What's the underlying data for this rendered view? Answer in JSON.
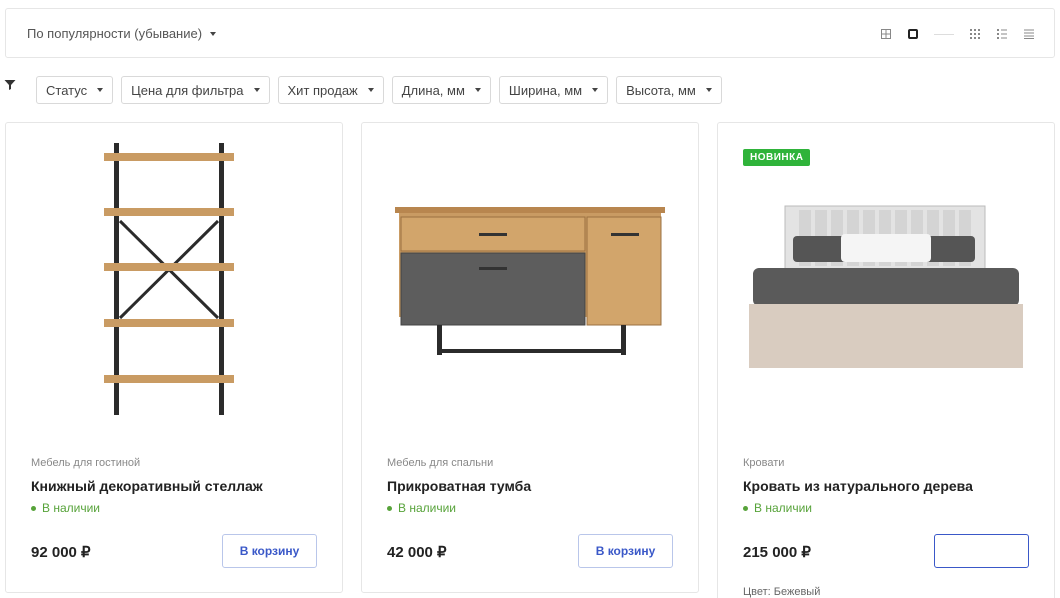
{
  "sort": {
    "label": "По популярности (убывание)"
  },
  "view_icons": [
    "grid-small-icon",
    "tile-large-icon",
    "grid-dense-icon",
    "list-icon",
    "table-icon"
  ],
  "filters": {
    "items": [
      "Статус",
      "Цена для фильтра",
      "Хит продаж",
      "Длина, мм",
      "Ширина, мм",
      "Высота, мм"
    ]
  },
  "products": [
    {
      "category": "Мебель для гостиной",
      "title": "Книжный декоративный стеллаж",
      "stock": "В наличии",
      "price": "92 000 ₽",
      "button": "В корзину"
    },
    {
      "category": "Мебель для спальни",
      "title": "Прикроватная тумба",
      "stock": "В наличии",
      "price": "42 000 ₽",
      "button": "В корзину"
    },
    {
      "badge": "НОВИНКА",
      "category": "Кровати",
      "title": "Кровать из натурального дерева",
      "stock": "В наличии",
      "price": "215 000 ₽",
      "button": "",
      "color": "Цвет: Бежевый"
    }
  ],
  "colors": {
    "accent": "#3a58c8",
    "stock": "#57a33a",
    "badge": "#2fb33a",
    "wood": "#c99b63"
  }
}
